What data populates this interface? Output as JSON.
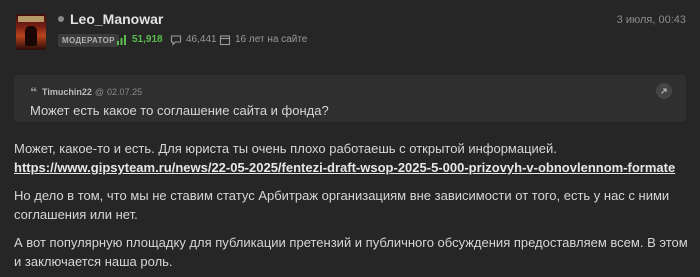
{
  "author": {
    "username": "Leo_Manowar",
    "role": "МОДЕРАТОР",
    "rating": "51,918",
    "comments": "46,441",
    "membership": "16 лет на сайте"
  },
  "post": {
    "date": "3 июля, 00:43",
    "quote": {
      "author": "Timuchin22",
      "at": "@",
      "date": "02.07.25",
      "text": "Может есть какое то соглашение сайта и фонда?"
    },
    "paragraphs": {
      "p1_text": "Может, какое-то и есть. Для юриста ты очень плохо работаешь с открытой информацией.",
      "p1_link": "https://www.gipsyteam.ru/news/22-05-2025/fentezi-draft-wsop-2025-5-000-prizovyh-v-obnovlennom-formate",
      "p2": "Но дело в том, что мы не ставим статус Арбитраж организациям вне зависимости от того, есть у нас с ними соглашения или нет.",
      "p3": "А вот популярную площадку для публикации претензий и публичного обсуждения предоставляем всем. В этом и заключается наша роль."
    }
  },
  "colors": {
    "background": "#262626",
    "quote_background": "#2f2f2f",
    "rating_green": "#5bbd4e",
    "text": "#d6d6d6",
    "muted": "#8c8c8c"
  },
  "icons": {
    "rating": "thumbs-up-chart-icon",
    "comments": "speech-bubble-icon",
    "membership": "calendar-icon",
    "quote": "quote-mark-icon",
    "jump": "arrow-up-right-icon",
    "online": "status-dot-icon"
  }
}
